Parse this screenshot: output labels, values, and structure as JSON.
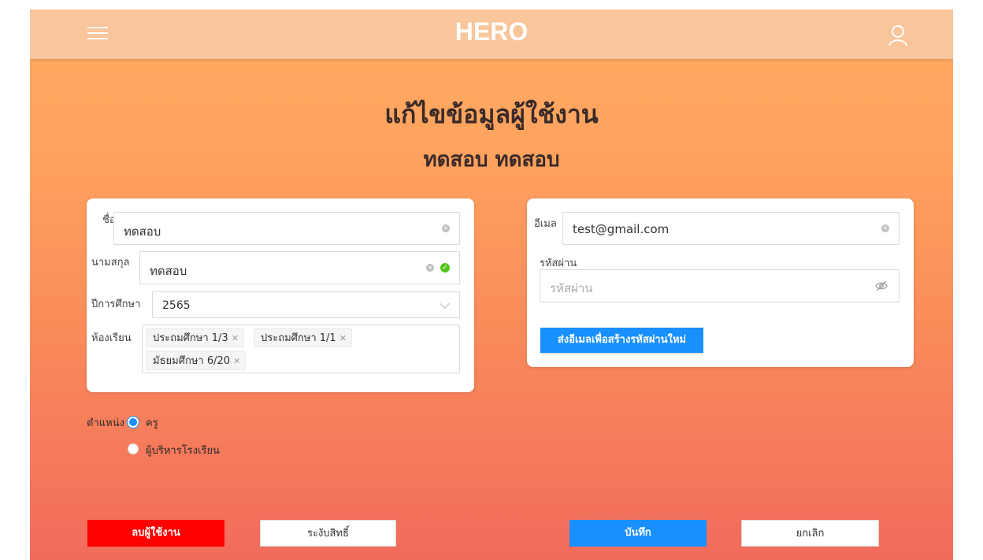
{
  "header": {
    "brand": "HERO"
  },
  "page": {
    "title": "แก้ไขข้อมูลผู้ใช้งาน",
    "subtitle": "ทดสอบ ทดสอบ"
  },
  "form": {
    "first_name_label": "ชื่อ",
    "first_name_value": "ทดสอบ",
    "last_name_label": "นามสกุล",
    "last_name_value": "ทดสอบ",
    "year_label": "ปีการศึกษา",
    "year_value": "2565",
    "classroom_label": "ห้องเรียน",
    "classrooms": [
      "ประถมศึกษา 1/3",
      "ประถมศึกษา 1/1",
      "มัธยมศึกษา 6/20"
    ],
    "email_label": "อีเมล",
    "email_value": "test@gmail.com",
    "password_label": "รหัสผ่าน",
    "password_placeholder": "รหัสผ่าน",
    "send_reset_label": "ส่งอีเมลเพื่อสร้างรหัสผ่านใหม่"
  },
  "role": {
    "label": "ตำแหน่ง",
    "options": [
      {
        "label": "ครู",
        "selected": true
      },
      {
        "label": "ผู้บริหารโรงเรียน",
        "selected": false
      }
    ]
  },
  "actions": {
    "delete_label": "ลบผู้ใช้งาน",
    "suspend_label": "ระงับสิทธิ์",
    "save_label": "บันทึก",
    "cancel_label": "ยกเลิก"
  },
  "icons": {
    "menu": "hamburger-menu-icon",
    "user": "user-icon",
    "clear": "clear-circle-icon",
    "valid": "check-circle-icon",
    "dropdown": "chevron-down-icon",
    "password_visibility": "eye-invisible-icon"
  },
  "colors": {
    "topbar": "#f9c59b",
    "gradient_top": "#ffab62",
    "gradient_bottom": "#f26b5c",
    "primary": "#1890ff",
    "danger": "#ff0000",
    "success": "#52c41a"
  }
}
